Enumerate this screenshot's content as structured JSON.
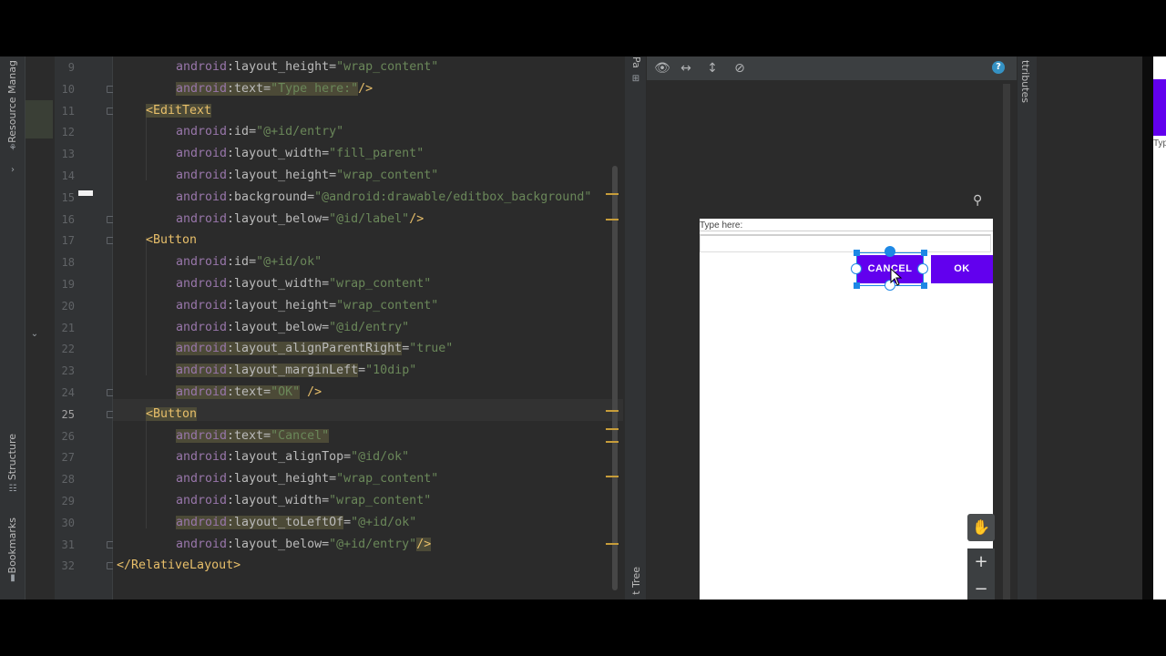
{
  "left_strip": {
    "resource_manager": "Resource Manag",
    "structure": "Structure",
    "bookmarks": "Bookmarks"
  },
  "line_numbers": [
    "9",
    "10",
    "11",
    "12",
    "13",
    "14",
    "15",
    "16",
    "17",
    "18",
    "19",
    "20",
    "21",
    "22",
    "23",
    "24",
    "25",
    "26",
    "27",
    "28",
    "29",
    "30",
    "31",
    "32"
  ],
  "code_lines": [
    [
      {
        "t": "android",
        "c": "ns"
      },
      {
        "t": ":layout_height=",
        "c": "attr"
      },
      {
        "t": "\"wrap_content\"",
        "c": "val"
      }
    ],
    [
      {
        "t": "android",
        "c": "ns",
        "h": 1
      },
      {
        "t": ":text=",
        "c": "attr",
        "h": 1
      },
      {
        "t": "\"Type here:\"",
        "c": "val",
        "h": 1
      },
      {
        "t": "/>",
        "c": "tag"
      }
    ],
    [
      {
        "t": "<EditText",
        "c": "tag",
        "h": 1
      }
    ],
    [
      {
        "t": "android",
        "c": "ns"
      },
      {
        "t": ":id=",
        "c": "attr"
      },
      {
        "t": "\"@+id/entry\"",
        "c": "val"
      }
    ],
    [
      {
        "t": "android",
        "c": "ns"
      },
      {
        "t": ":layout_width=",
        "c": "attr"
      },
      {
        "t": "\"fill_parent\"",
        "c": "val"
      }
    ],
    [
      {
        "t": "android",
        "c": "ns"
      },
      {
        "t": ":layout_height=",
        "c": "attr"
      },
      {
        "t": "\"wrap_content\"",
        "c": "val"
      }
    ],
    [
      {
        "t": "android",
        "c": "ns"
      },
      {
        "t": ":background=",
        "c": "attr"
      },
      {
        "t": "\"@android:drawable/editbox_background\"",
        "c": "val"
      }
    ],
    [
      {
        "t": "android",
        "c": "ns"
      },
      {
        "t": ":layout_below=",
        "c": "attr"
      },
      {
        "t": "\"@id/label\"",
        "c": "val"
      },
      {
        "t": "/>",
        "c": "tag"
      }
    ],
    [
      {
        "t": "<Button",
        "c": "tag"
      }
    ],
    [
      {
        "t": "android",
        "c": "ns"
      },
      {
        "t": ":id=",
        "c": "attr"
      },
      {
        "t": "\"@+id/ok\"",
        "c": "val"
      }
    ],
    [
      {
        "t": "android",
        "c": "ns"
      },
      {
        "t": ":layout_width=",
        "c": "attr"
      },
      {
        "t": "\"wrap_content\"",
        "c": "val"
      }
    ],
    [
      {
        "t": "android",
        "c": "ns"
      },
      {
        "t": ":layout_height=",
        "c": "attr"
      },
      {
        "t": "\"wrap_content\"",
        "c": "val"
      }
    ],
    [
      {
        "t": "android",
        "c": "ns"
      },
      {
        "t": ":layout_below=",
        "c": "attr"
      },
      {
        "t": "\"@id/entry\"",
        "c": "val"
      }
    ],
    [
      {
        "t": "android",
        "c": "ns",
        "h": 1
      },
      {
        "t": ":layout_alignParentRight",
        "c": "attr",
        "h": 1
      },
      {
        "t": "=",
        "c": "attr"
      },
      {
        "t": "\"true\"",
        "c": "val"
      }
    ],
    [
      {
        "t": "android",
        "c": "ns",
        "h": 1
      },
      {
        "t": ":layout_marginLeft",
        "c": "attr",
        "h": 1
      },
      {
        "t": "=",
        "c": "attr"
      },
      {
        "t": "\"10dip\"",
        "c": "val"
      }
    ],
    [
      {
        "t": "android",
        "c": "ns",
        "h": 1
      },
      {
        "t": ":text=",
        "c": "attr",
        "h": 1
      },
      {
        "t": "\"OK\"",
        "c": "val",
        "h": 1
      },
      {
        "t": " />",
        "c": "tag"
      }
    ],
    [
      {
        "t": "<Button",
        "c": "tag",
        "h": 1
      }
    ],
    [
      {
        "t": "android",
        "c": "ns",
        "h": 1
      },
      {
        "t": ":text=",
        "c": "attr",
        "h": 1
      },
      {
        "t": "\"Cancel\"",
        "c": "val",
        "h": 1
      }
    ],
    [
      {
        "t": "android",
        "c": "ns"
      },
      {
        "t": ":layout_alignTop=",
        "c": "attr"
      },
      {
        "t": "\"@id/ok\"",
        "c": "val"
      }
    ],
    [
      {
        "t": "android",
        "c": "ns"
      },
      {
        "t": ":layout_height=",
        "c": "attr"
      },
      {
        "t": "\"wrap_content\"",
        "c": "val"
      }
    ],
    [
      {
        "t": "android",
        "c": "ns"
      },
      {
        "t": ":layout_width=",
        "c": "attr"
      },
      {
        "t": "\"wrap_content\"",
        "c": "val"
      }
    ],
    [
      {
        "t": "android",
        "c": "ns",
        "h": 1
      },
      {
        "t": ":layout_toLeftOf",
        "c": "attr",
        "h": 1
      },
      {
        "t": "=",
        "c": "attr"
      },
      {
        "t": "\"@+id/ok\"",
        "c": "val"
      }
    ],
    [
      {
        "t": "android",
        "c": "ns"
      },
      {
        "t": ":layout_below=",
        "c": "attr"
      },
      {
        "t": "\"@+id/entry\"",
        "c": "val"
      },
      {
        "t": "/>",
        "c": "tag",
        "h": 1
      }
    ],
    [
      {
        "t": "</RelativeLayout>",
        "c": "tag"
      }
    ]
  ],
  "current_line": "25",
  "design": {
    "palette_label": "Pa",
    "component_tree_label": "t Tree",
    "attributes_label": "ttributes",
    "help_label": "?",
    "preview": {
      "label_text": "Type here:",
      "cancel_button": "CANCEL",
      "ok_button": "OK"
    },
    "zoom_in": "+",
    "zoom_out": "−",
    "edge_text": "Typ"
  },
  "colors": {
    "accent": "#6200ee",
    "selection": "#1e88e5",
    "tag": "#e8bf6a",
    "string": "#6a8759",
    "namespace": "#9876aa"
  }
}
